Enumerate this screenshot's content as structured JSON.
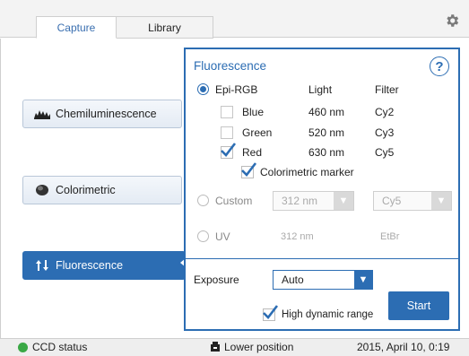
{
  "tabs": {
    "capture": "Capture",
    "library": "Library"
  },
  "left_modes": [
    {
      "label": "Chemiluminescence",
      "icon": "chemiluminescence-icon"
    },
    {
      "label": "Colorimetric",
      "icon": "colorimetric-icon"
    },
    {
      "label": "Fluorescence",
      "icon": "fluorescence-arrows-icon"
    }
  ],
  "panel": {
    "title": "Fluorescence",
    "help": "?",
    "epi_rgb": {
      "label": "Epi-RGB",
      "col_light": "Light",
      "col_filter": "Filter",
      "channels": [
        {
          "name": "Blue",
          "light": "460 nm",
          "filter": "Cy2",
          "checked": false
        },
        {
          "name": "Green",
          "light": "520 nm",
          "filter": "Cy3",
          "checked": false
        },
        {
          "name": "Red",
          "light": "630 nm",
          "filter": "Cy5",
          "checked": true
        }
      ],
      "colorimetric_marker": "Colorimetric marker"
    },
    "custom": {
      "label": "Custom",
      "light_value": "312 nm",
      "filter_value": "Cy5"
    },
    "uv": {
      "label": "UV",
      "light": "312 nm",
      "filter": "EtBr"
    },
    "exposure": {
      "label": "Exposure",
      "value": "Auto"
    },
    "hdr": {
      "label": "High dynamic range",
      "checked": true
    },
    "start": "Start"
  },
  "status": {
    "ccd": "CCD status",
    "position": "Lower position",
    "datetime": "2015, April 10, 0:19"
  },
  "colors": {
    "accent": "#2c6db3",
    "status_ok": "#3aa845"
  }
}
